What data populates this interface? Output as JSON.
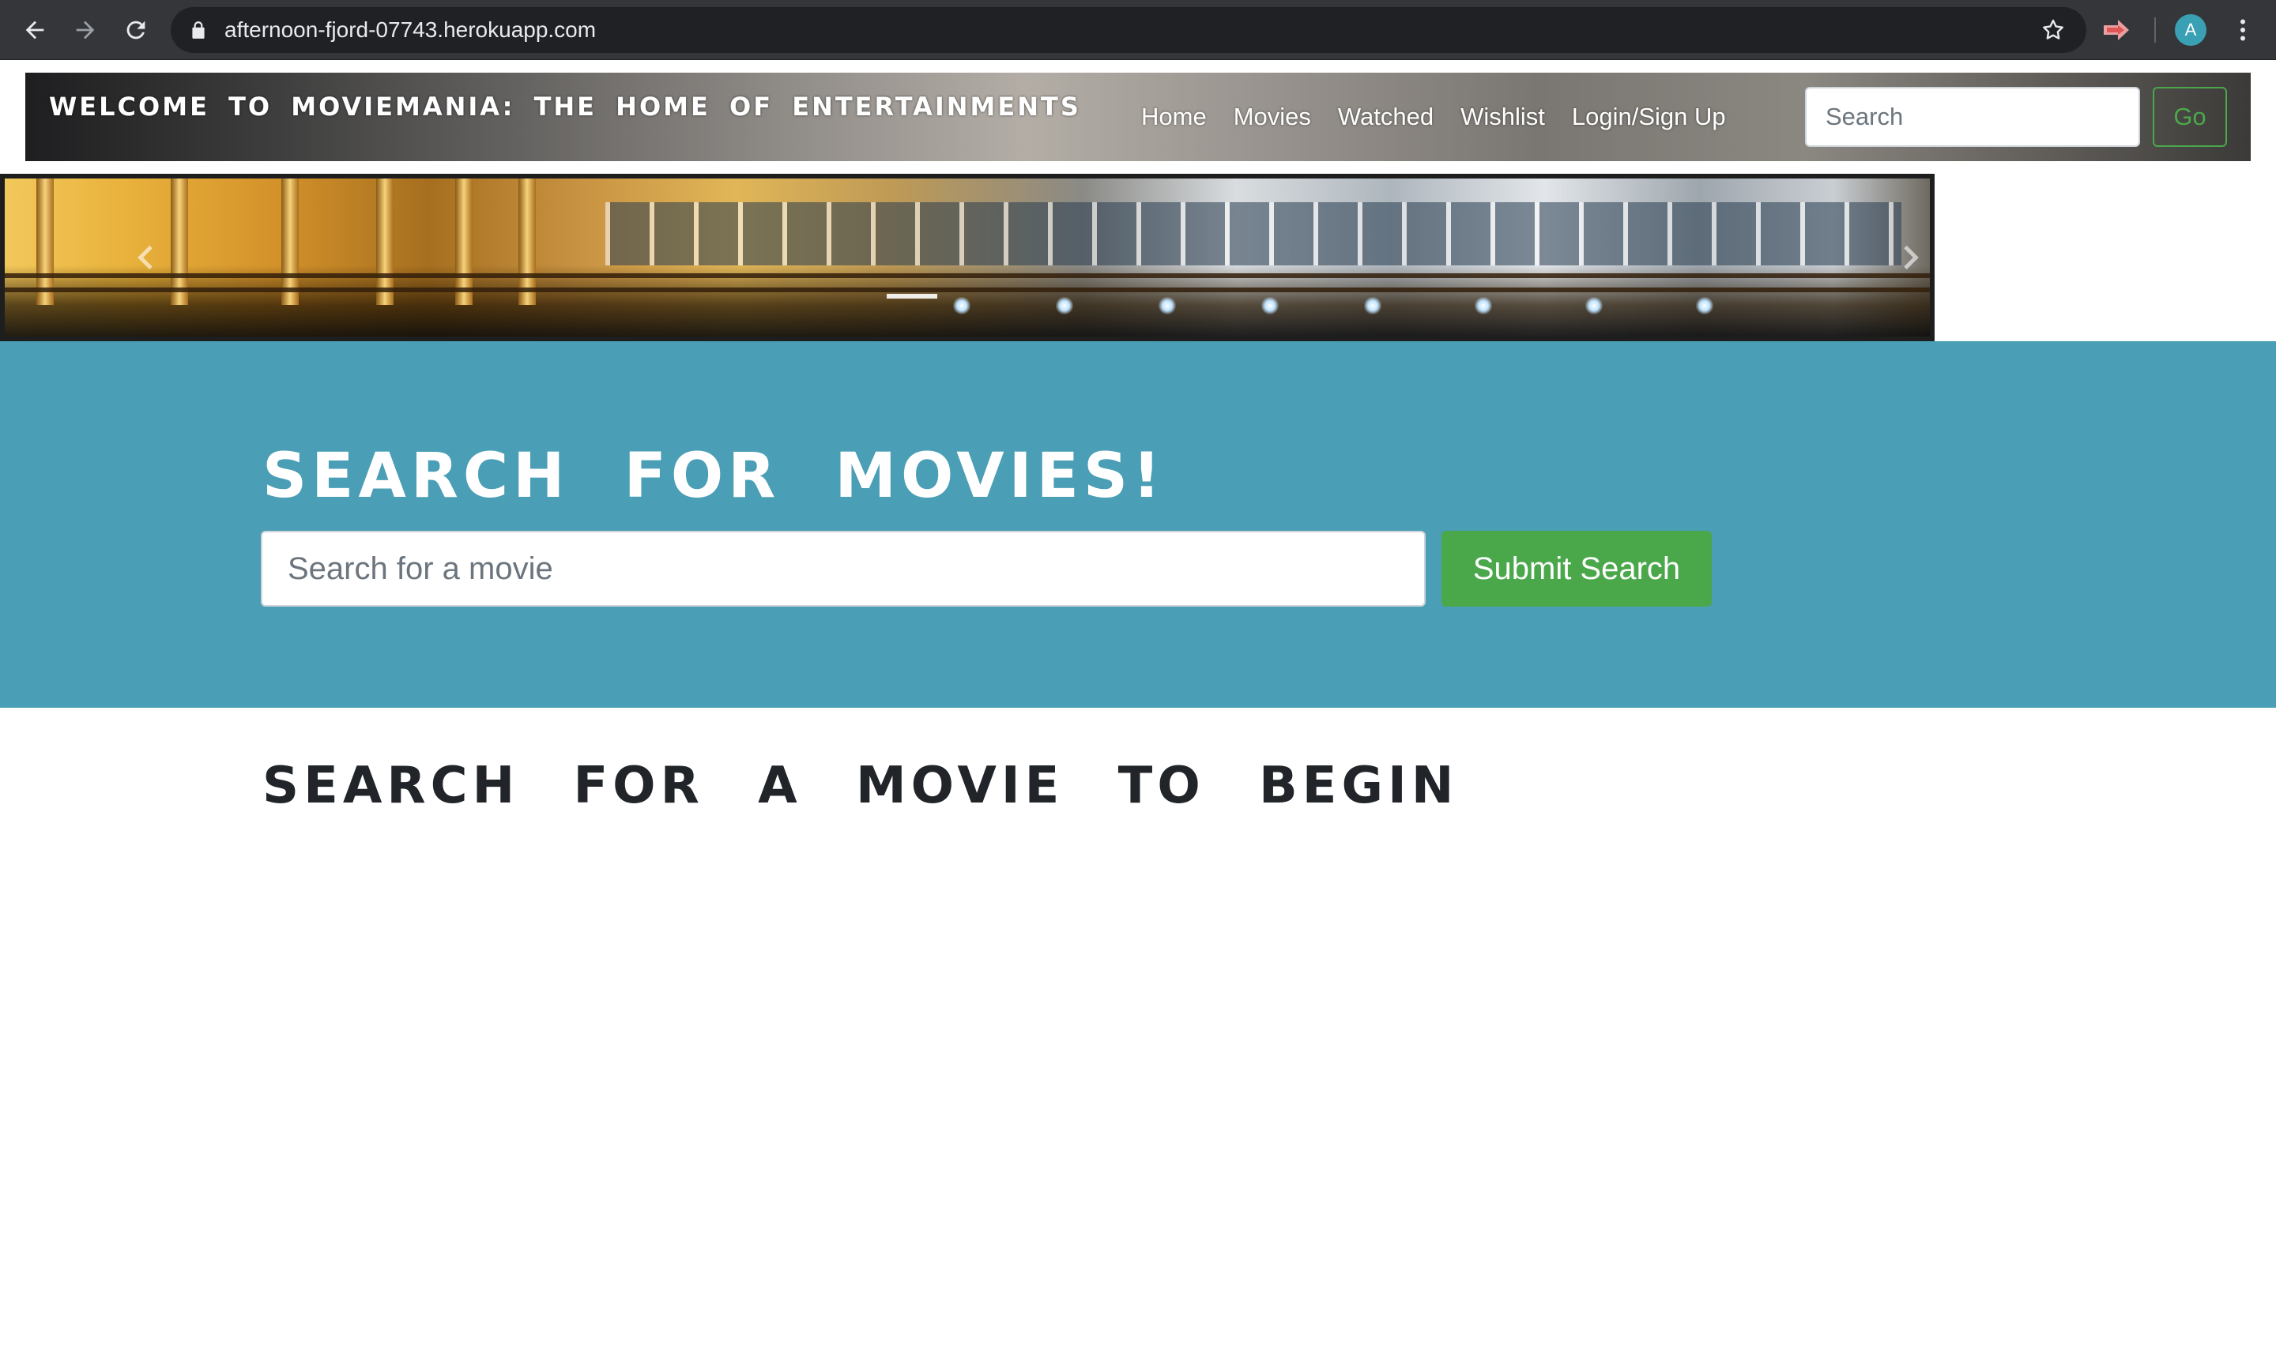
{
  "browser": {
    "url": "afternoon-fjord-07743.herokuapp.com",
    "profile_initial": "A",
    "icons": [
      "back-arrow-icon",
      "forward-arrow-icon",
      "reload-icon",
      "lock-icon",
      "star-icon",
      "extension-icon",
      "kebab-menu-icon"
    ]
  },
  "navbar": {
    "brand": "WELCOME TO MOVIEMANIA: THE HOME OF ENTERTAINMENTS",
    "links": [
      "Home",
      "Movies",
      "Watched",
      "Wishlist",
      "Login/Sign Up"
    ],
    "search_placeholder": "Search",
    "go_label": "Go"
  },
  "jumbotron": {
    "title": "SEARCH FOR MOVIES!",
    "search_placeholder": "Search for a movie",
    "submit_label": "Submit Search"
  },
  "results": {
    "heading": "SEARCH FOR A MOVIE TO BEGIN"
  },
  "colors": {
    "jumbotron_bg": "#4a9eb5",
    "button_green": "#4aa84a",
    "browser_chrome": "#35363a",
    "avatar": "#3aa0b3"
  }
}
